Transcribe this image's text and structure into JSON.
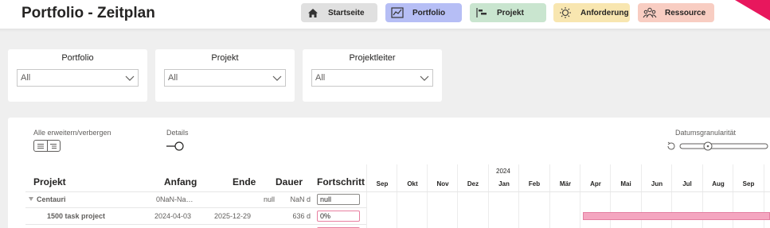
{
  "header": {
    "title": "Portfolio - Zeitplan",
    "nav": [
      {
        "label": "Startseite",
        "icon": "home-icon",
        "color": "#e0e0e0"
      },
      {
        "label": "Portfolio",
        "icon": "chart-icon",
        "color": "#b6bef5"
      },
      {
        "label": "Projekt",
        "icon": "gantt-icon",
        "color": "#c9e5cf"
      },
      {
        "label": "Anforderung",
        "icon": "lightbulb-icon",
        "color": "#f8e6b0"
      },
      {
        "label": "Ressource",
        "icon": "people-icon",
        "color": "#f8cdc2"
      }
    ],
    "accent": "#e8175d"
  },
  "filters": [
    {
      "title": "Portfolio",
      "value": "All"
    },
    {
      "title": "Projekt",
      "value": "All"
    },
    {
      "title": "Projektleiter",
      "value": "All"
    }
  ],
  "controls": {
    "expand_label": "Alle erweitern/verbergen",
    "details_label": "Details",
    "granularity_label": "Datumsgranularität"
  },
  "table": {
    "columns": [
      "Projekt",
      "Anfang",
      "Ende",
      "Dauer",
      "Fortschritt"
    ],
    "year": "2024",
    "months": [
      "Sep",
      "Okt",
      "Nov",
      "Dez",
      "Jan",
      "Feb",
      "Mär",
      "Apr",
      "Mai",
      "Jun",
      "Jul",
      "Aug",
      "Sep"
    ],
    "rows": [
      {
        "name": "Centauri",
        "start": "0NaN-Na…",
        "end": "null",
        "duration": "NaN d",
        "progress": "null",
        "level": 0,
        "expanded": true
      },
      {
        "name": "1500 task project",
        "start": "2024-04-03",
        "end": "2025-12-29",
        "duration": "636 d",
        "progress": "0%",
        "level": 1
      }
    ],
    "bar_color": "#f4a6c0"
  }
}
